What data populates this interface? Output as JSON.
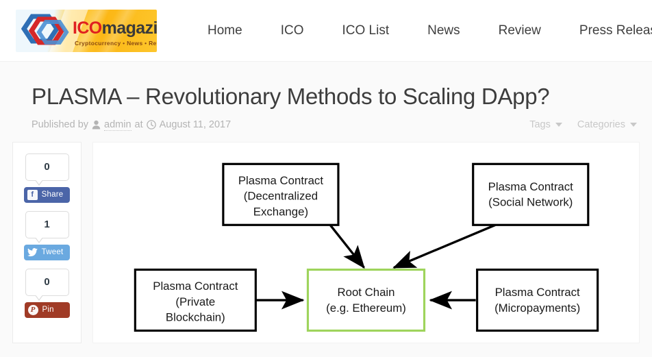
{
  "header": {
    "logo": {
      "name_part1": "ICO",
      "name_part2": "magazine",
      "tagline": "Cryptocurrency • News • Review"
    },
    "nav": [
      {
        "label": "Home"
      },
      {
        "label": "ICO"
      },
      {
        "label": "ICO List"
      },
      {
        "label": "News"
      },
      {
        "label": "Review"
      },
      {
        "label": "Press Release"
      }
    ]
  },
  "article": {
    "title": "PLASMA – Revolutionary Methods to Scaling DApp?",
    "meta": {
      "published_by_label": "Published by",
      "author": "admin",
      "at_label": "at",
      "date": "August 11, 2017",
      "author_icon": "person-icon",
      "date_icon": "clock-icon"
    },
    "tags_label": "Tags",
    "categories_label": "Categories"
  },
  "share": {
    "items": [
      {
        "count": "0",
        "label": "Share",
        "network": "facebook",
        "glyph": "f",
        "color": "#4b65a8",
        "glyph_color": "#4b65a8"
      },
      {
        "count": "1",
        "label": "Tweet",
        "network": "twitter",
        "glyph": "t",
        "color": "#6aa9e0",
        "glyph_color": "#6aa9e0"
      },
      {
        "count": "0",
        "label": "Pin",
        "network": "pinterest",
        "glyph": "P",
        "color": "#a03b26",
        "glyph_color": "#a03b26"
      }
    ]
  },
  "diagram": {
    "accent_green": "#9ed45c",
    "line_color": "#000000",
    "box_fill": "#ffffff",
    "nodes": [
      {
        "id": "dex",
        "lines": [
          "Plasma Contract",
          "(Decentralized",
          "Exchange)"
        ]
      },
      {
        "id": "social",
        "lines": [
          "Plasma Contract",
          "(Social Network)"
        ]
      },
      {
        "id": "private",
        "lines": [
          "Plasma Contract",
          "(Private",
          "Blockchain)"
        ]
      },
      {
        "id": "root",
        "lines": [
          "Root Chain",
          "(e.g. Ethereum)"
        ]
      },
      {
        "id": "micro",
        "lines": [
          "Plasma Contract",
          "(Micropayments)"
        ]
      }
    ]
  }
}
